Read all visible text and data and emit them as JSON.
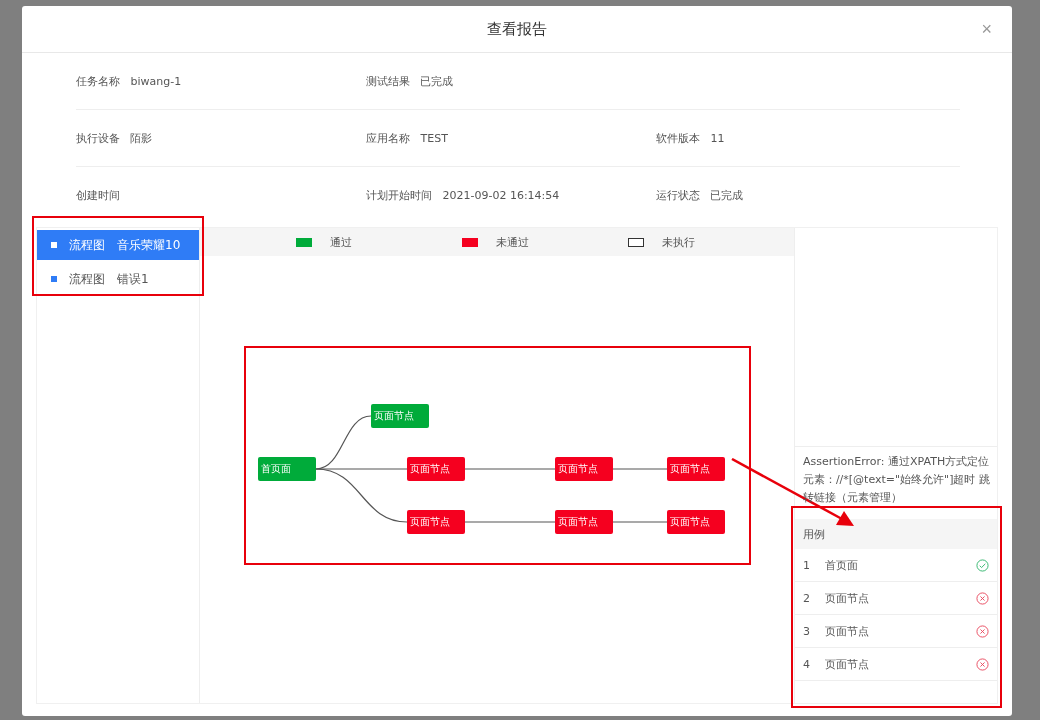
{
  "dialog": {
    "title": "查看报告",
    "close": "×"
  },
  "info_rows": [
    [
      {
        "label": "任务名称",
        "value": "biwang-1"
      },
      {
        "label": "测试结果",
        "value": "已完成"
      }
    ],
    [
      {
        "label": "执行设备",
        "value": "陌影"
      },
      {
        "label": "应用名称",
        "value": "TEST"
      },
      {
        "label": "软件版本",
        "value": "11"
      }
    ],
    [
      {
        "label": "创建时间"
      },
      {
        "label": "计划开始时间",
        "value": "2021-09-02 16:14:54"
      },
      {
        "label": "运行状态",
        "value": "已完成"
      }
    ]
  ],
  "flows": [
    {
      "type": "流程图",
      "name": "音乐荣耀10",
      "selected": true
    },
    {
      "type": "流程图",
      "name": "错误1",
      "selected": false
    }
  ],
  "legend": [
    {
      "label": "通过",
      "kind": "pass"
    },
    {
      "label": "未通过",
      "kind": "fail"
    },
    {
      "label": "未执行",
      "kind": "pending"
    }
  ],
  "graph": {
    "nodes": [
      {
        "label": "首页面",
        "passed": true
      },
      {
        "label": "页面节点",
        "passed": true
      },
      {
        "label": "页面节点",
        "passed": false
      },
      {
        "label": "页面节点",
        "passed": false
      },
      {
        "label": "页面节点",
        "passed": false
      },
      {
        "label": "页面节点",
        "passed": false
      },
      {
        "label": "页面节点",
        "passed": false
      },
      {
        "label": "页面节点",
        "passed": false
      }
    ]
  },
  "error_message": "AssertionError: 通过XPATH方式定位元素：//*[@text=\"始终允许\"]超时 跳转链接（元素管理）",
  "cases_header": "用例",
  "cases": [
    {
      "no": "1",
      "name": "首页面",
      "passed": true
    },
    {
      "no": "2",
      "name": "页面节点",
      "passed": false
    },
    {
      "no": "3",
      "name": "页面节点",
      "passed": false
    },
    {
      "no": "4",
      "name": "页面节点",
      "passed": false
    }
  ]
}
